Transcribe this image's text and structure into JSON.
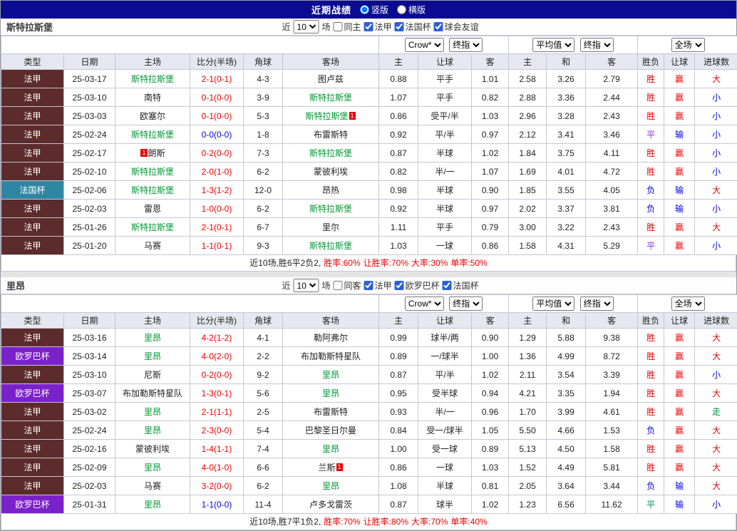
{
  "topbar": {
    "title": "近期战绩",
    "layout_options": [
      {
        "label": "竖版",
        "selected": true
      },
      {
        "label": "横版",
        "selected": false
      }
    ]
  },
  "table_headers": [
    "类型",
    "日期",
    "主场",
    "比分(半场)",
    "角球",
    "客场",
    "主",
    "让球",
    "客",
    "主",
    "和",
    "客",
    "胜负",
    "让球",
    "进球数"
  ],
  "dropdowns": {
    "provider": "Crow*",
    "provider_stage": "终指",
    "average": "平均值",
    "average_stage": "终指",
    "fulltime": "全场"
  },
  "colors": {
    "topbar_bg": "#0b0b92",
    "ligue1_bg": "#5c2b2b",
    "coupe_de_france_bg": "#2f86a3",
    "europa_bg": "#7b21c9",
    "focus_team_green": "#009933",
    "win_red": "#ee0000",
    "lose_blue": "#0000e8"
  },
  "sections": [
    {
      "team": "斯特拉斯堡",
      "filter": {
        "near": "近",
        "count": "10",
        "games": "场",
        "checks": [
          {
            "label": "同主",
            "on": false
          },
          {
            "label": "法甲",
            "on": true
          },
          {
            "label": "法国杯",
            "on": true
          },
          {
            "label": "球会友谊",
            "on": true
          }
        ]
      },
      "rows": [
        {
          "comp": "法甲",
          "cc": "l1",
          "date": "25-03-17",
          "home": {
            "t": "斯特拉斯堡",
            "g": true
          },
          "score": {
            "t": "2-1(0-1)",
            "c": "r"
          },
          "corner": "4-3",
          "away": {
            "t": "图卢兹"
          },
          "ah": [
            "0.88",
            "平手",
            "1.01"
          ],
          "eu": [
            "2.58",
            "3.26",
            "2.79"
          ],
          "res": [
            [
              "胜",
              "r"
            ],
            [
              "赢",
              "r"
            ],
            [
              "大",
              "r"
            ]
          ]
        },
        {
          "comp": "法甲",
          "cc": "l1",
          "date": "25-03-10",
          "home": {
            "t": "南特"
          },
          "score": {
            "t": "0-1(0-0)",
            "c": "r"
          },
          "corner": "3-9",
          "away": {
            "t": "斯特拉斯堡",
            "g": true
          },
          "ah": [
            "1.07",
            "平手",
            "0.82"
          ],
          "eu": [
            "2.88",
            "3.36",
            "2.44"
          ],
          "res": [
            [
              "胜",
              "r"
            ],
            [
              "赢",
              "r"
            ],
            [
              "小",
              "b"
            ]
          ]
        },
        {
          "comp": "法甲",
          "cc": "l1",
          "date": "25-03-03",
          "home": {
            "t": "欧塞尔"
          },
          "score": {
            "t": "0-1(0-0)",
            "c": "r"
          },
          "corner": "5-3",
          "away": {
            "t": "斯特拉斯堡",
            "g": true,
            "ba": "1"
          },
          "ah": [
            "0.86",
            "受平/半",
            "1.03"
          ],
          "eu": [
            "2.96",
            "3.28",
            "2.43"
          ],
          "res": [
            [
              "胜",
              "r"
            ],
            [
              "赢",
              "r"
            ],
            [
              "小",
              "b"
            ]
          ]
        },
        {
          "comp": "法甲",
          "cc": "l1",
          "date": "25-02-24",
          "home": {
            "t": "斯特拉斯堡",
            "g": true
          },
          "score": {
            "t": "0-0(0-0)",
            "c": "b"
          },
          "corner": "1-8",
          "away": {
            "t": "布雷斯特"
          },
          "ah": [
            "0.92",
            "平/半",
            "0.97"
          ],
          "eu": [
            "2.12",
            "3.41",
            "3.46"
          ],
          "res": [
            [
              "平",
              "p"
            ],
            [
              "输",
              "b"
            ],
            [
              "小",
              "b"
            ]
          ]
        },
        {
          "comp": "法甲",
          "cc": "l1",
          "date": "25-02-17",
          "home": {
            "t": "朗斯",
            "bb": "1"
          },
          "score": {
            "t": "0-2(0-0)",
            "c": "r"
          },
          "corner": "7-3",
          "away": {
            "t": "斯特拉斯堡",
            "g": true
          },
          "ah": [
            "0.87",
            "半球",
            "1.02"
          ],
          "eu": [
            "1.84",
            "3.75",
            "4.11"
          ],
          "res": [
            [
              "胜",
              "r"
            ],
            [
              "赢",
              "r"
            ],
            [
              "小",
              "b"
            ]
          ]
        },
        {
          "comp": "法甲",
          "cc": "l1",
          "date": "25-02-10",
          "home": {
            "t": "斯特拉斯堡",
            "g": true
          },
          "score": {
            "t": "2-0(1-0)",
            "c": "r"
          },
          "corner": "6-2",
          "away": {
            "t": "蒙彼利埃"
          },
          "ah": [
            "0.82",
            "半/一",
            "1.07"
          ],
          "eu": [
            "1.69",
            "4.01",
            "4.72"
          ],
          "res": [
            [
              "胜",
              "r"
            ],
            [
              "赢",
              "r"
            ],
            [
              "小",
              "b"
            ]
          ]
        },
        {
          "comp": "法国杯",
          "cc": "fc",
          "date": "25-02-06",
          "home": {
            "t": "斯特拉斯堡",
            "g": true
          },
          "score": {
            "t": "1-3(1-2)",
            "c": "r"
          },
          "corner": "12-0",
          "away": {
            "t": "昂热"
          },
          "ah": [
            "0.98",
            "半球",
            "0.90"
          ],
          "eu": [
            "1.85",
            "3.55",
            "4.05"
          ],
          "res": [
            [
              "负",
              "b"
            ],
            [
              "输",
              "b"
            ],
            [
              "大",
              "r"
            ]
          ]
        },
        {
          "comp": "法甲",
          "cc": "l1",
          "date": "25-02-03",
          "home": {
            "t": "雷恩"
          },
          "score": {
            "t": "1-0(0-0)",
            "c": "r"
          },
          "corner": "6-2",
          "away": {
            "t": "斯特拉斯堡",
            "g": true
          },
          "ah": [
            "0.92",
            "半球",
            "0.97"
          ],
          "eu": [
            "2.02",
            "3.37",
            "3.81"
          ],
          "res": [
            [
              "负",
              "b"
            ],
            [
              "输",
              "b"
            ],
            [
              "小",
              "b"
            ]
          ]
        },
        {
          "comp": "法甲",
          "cc": "l1",
          "date": "25-01-26",
          "home": {
            "t": "斯特拉斯堡",
            "g": true
          },
          "score": {
            "t": "2-1(0-1)",
            "c": "r"
          },
          "corner": "6-7",
          "away": {
            "t": "里尔"
          },
          "ah": [
            "1.11",
            "平手",
            "0.79"
          ],
          "eu": [
            "3.00",
            "3.22",
            "2.43"
          ],
          "res": [
            [
              "胜",
              "r"
            ],
            [
              "赢",
              "r"
            ],
            [
              "大",
              "r"
            ]
          ]
        },
        {
          "comp": "法甲",
          "cc": "l1",
          "date": "25-01-20",
          "home": {
            "t": "马赛"
          },
          "score": {
            "t": "1-1(0-1)",
            "c": "r"
          },
          "corner": "9-3",
          "away": {
            "t": "斯特拉斯堡",
            "g": true
          },
          "ah": [
            "1.03",
            "一球",
            "0.86"
          ],
          "eu": [
            "1.58",
            "4.31",
            "5.29"
          ],
          "res": [
            [
              "平",
              "p"
            ],
            [
              "赢",
              "r"
            ],
            [
              "小",
              "b"
            ]
          ]
        }
      ],
      "summary": [
        {
          "t": "近10场,胜6平2负2,",
          "c": "k"
        },
        {
          "t": "胜率:60%",
          "c": "r"
        },
        {
          "t": "让胜率:70%",
          "c": "r"
        },
        {
          "t": "大率:30%",
          "c": "r"
        },
        {
          "t": "单率:50%",
          "c": "r"
        }
      ]
    },
    {
      "team": "里昂",
      "filter": {
        "near": "近",
        "count": "10",
        "games": "场",
        "checks": [
          {
            "label": "同客",
            "on": false
          },
          {
            "label": "法甲",
            "on": true
          },
          {
            "label": "欧罗巴杯",
            "on": true
          },
          {
            "label": "法国杯",
            "on": true
          }
        ]
      },
      "rows": [
        {
          "comp": "法甲",
          "cc": "l1",
          "date": "25-03-16",
          "home": {
            "t": "里昂",
            "g": true
          },
          "score": {
            "t": "4-2(1-2)",
            "c": "r"
          },
          "corner": "4-1",
          "away": {
            "t": "勒阿弗尔"
          },
          "ah": [
            "0.99",
            "球半/两",
            "0.90"
          ],
          "eu": [
            "1.29",
            "5.88",
            "9.38"
          ],
          "res": [
            [
              "胜",
              "r"
            ],
            [
              "赢",
              "r"
            ],
            [
              "大",
              "r"
            ]
          ]
        },
        {
          "comp": "欧罗巴杯",
          "cc": "el",
          "date": "25-03-14",
          "home": {
            "t": "里昂",
            "g": true
          },
          "score": {
            "t": "4-0(2-0)",
            "c": "r"
          },
          "corner": "2-2",
          "away": {
            "t": "布加勒斯特星队"
          },
          "ah": [
            "0.89",
            "一/球半",
            "1.00"
          ],
          "eu": [
            "1.36",
            "4.99",
            "8.72"
          ],
          "res": [
            [
              "胜",
              "r"
            ],
            [
              "赢",
              "r"
            ],
            [
              "大",
              "r"
            ]
          ]
        },
        {
          "comp": "法甲",
          "cc": "l1",
          "date": "25-03-10",
          "home": {
            "t": "尼斯"
          },
          "score": {
            "t": "0-2(0-0)",
            "c": "r"
          },
          "corner": "9-2",
          "away": {
            "t": "里昂",
            "g": true
          },
          "ah": [
            "0.87",
            "平/半",
            "1.02"
          ],
          "eu": [
            "2.11",
            "3.54",
            "3.39"
          ],
          "res": [
            [
              "胜",
              "r"
            ],
            [
              "赢",
              "r"
            ],
            [
              "小",
              "b"
            ]
          ]
        },
        {
          "comp": "欧罗巴杯",
          "cc": "el",
          "date": "25-03-07",
          "home": {
            "t": "布加勒斯特星队"
          },
          "score": {
            "t": "1-3(0-1)",
            "c": "r"
          },
          "corner": "5-6",
          "away": {
            "t": "里昂",
            "g": true
          },
          "ah": [
            "0.95",
            "受半球",
            "0.94"
          ],
          "eu": [
            "4.21",
            "3.35",
            "1.94"
          ],
          "res": [
            [
              "胜",
              "r"
            ],
            [
              "赢",
              "r"
            ],
            [
              "大",
              "r"
            ]
          ]
        },
        {
          "comp": "法甲",
          "cc": "l1",
          "date": "25-03-02",
          "home": {
            "t": "里昂",
            "g": true
          },
          "score": {
            "t": "2-1(1-1)",
            "c": "r"
          },
          "corner": "2-5",
          "away": {
            "t": "布雷斯特"
          },
          "ah": [
            "0.93",
            "半/一",
            "0.96"
          ],
          "eu": [
            "1.70",
            "3.99",
            "4.61"
          ],
          "res": [
            [
              "胜",
              "r"
            ],
            [
              "赢",
              "r"
            ],
            [
              "走",
              "g"
            ]
          ]
        },
        {
          "comp": "法甲",
          "cc": "l1",
          "date": "25-02-24",
          "home": {
            "t": "里昂",
            "g": true
          },
          "score": {
            "t": "2-3(0-0)",
            "c": "r"
          },
          "corner": "5-4",
          "away": {
            "t": "巴黎圣日尔曼"
          },
          "ah": [
            "0.84",
            "受一/球半",
            "1.05"
          ],
          "eu": [
            "5.50",
            "4.66",
            "1.53"
          ],
          "res": [
            [
              "负",
              "b"
            ],
            [
              "赢",
              "r"
            ],
            [
              "大",
              "r"
            ]
          ]
        },
        {
          "comp": "法甲",
          "cc": "l1",
          "date": "25-02-16",
          "home": {
            "t": "蒙彼利埃"
          },
          "score": {
            "t": "1-4(1-1)",
            "c": "r"
          },
          "corner": "7-4",
          "away": {
            "t": "里昂",
            "g": true
          },
          "ah": [
            "1.00",
            "受一球",
            "0.89"
          ],
          "eu": [
            "5.13",
            "4.50",
            "1.58"
          ],
          "res": [
            [
              "胜",
              "r"
            ],
            [
              "赢",
              "r"
            ],
            [
              "大",
              "r"
            ]
          ]
        },
        {
          "comp": "法甲",
          "cc": "l1",
          "date": "25-02-09",
          "home": {
            "t": "里昂",
            "g": true
          },
          "score": {
            "t": "4-0(1-0)",
            "c": "r"
          },
          "corner": "6-6",
          "away": {
            "t": "兰斯",
            "ba": "1"
          },
          "ah": [
            "0.86",
            "一球",
            "1.03"
          ],
          "eu": [
            "1.52",
            "4.49",
            "5.81"
          ],
          "res": [
            [
              "胜",
              "r"
            ],
            [
              "赢",
              "r"
            ],
            [
              "大",
              "r"
            ]
          ]
        },
        {
          "comp": "法甲",
          "cc": "l1",
          "date": "25-02-03",
          "home": {
            "t": "马赛"
          },
          "score": {
            "t": "3-2(0-0)",
            "c": "r"
          },
          "corner": "6-2",
          "away": {
            "t": "里昂",
            "g": true
          },
          "ah": [
            "1.08",
            "半球",
            "0.81"
          ],
          "eu": [
            "2.05",
            "3.64",
            "3.44"
          ],
          "res": [
            [
              "负",
              "b"
            ],
            [
              "输",
              "b"
            ],
            [
              "大",
              "r"
            ]
          ]
        },
        {
          "comp": "欧罗巴杯",
          "cc": "el",
          "date": "25-01-31",
          "home": {
            "t": "里昂",
            "g": true
          },
          "score": {
            "t": "1-1(0-0)",
            "c": "b"
          },
          "corner": "11-4",
          "away": {
            "t": "卢多戈雷茨"
          },
          "ah": [
            "0.87",
            "球半",
            "1.02"
          ],
          "eu": [
            "1.23",
            "6.56",
            "11.62"
          ],
          "res": [
            [
              "平",
              "g"
            ],
            [
              "输",
              "b"
            ],
            [
              "小",
              "b"
            ]
          ]
        }
      ],
      "summary": [
        {
          "t": "近10场,胜7平1负2,",
          "c": "k"
        },
        {
          "t": "胜率:70%",
          "c": "r"
        },
        {
          "t": "让胜率:80%",
          "c": "r"
        },
        {
          "t": "大率:70%",
          "c": "r"
        },
        {
          "t": "单率:40%",
          "c": "r"
        }
      ]
    }
  ]
}
